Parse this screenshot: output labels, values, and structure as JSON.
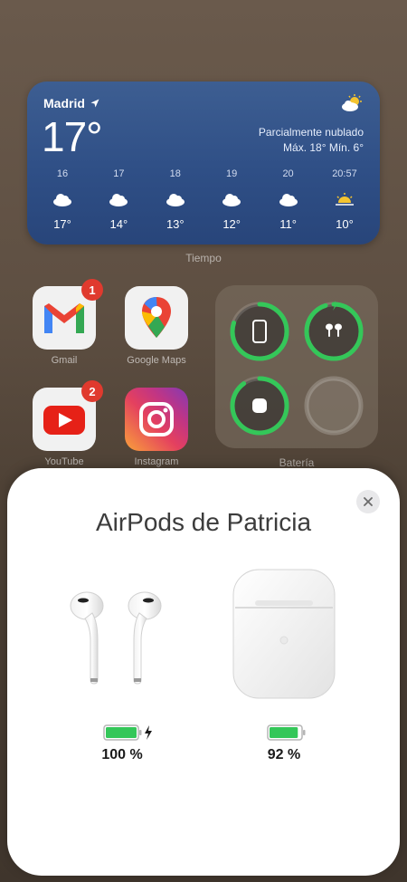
{
  "weather": {
    "city": "Madrid",
    "temp": "17°",
    "condition": "Parcialmente nublado",
    "range": "Máx. 18° Mín. 6°",
    "hours": [
      {
        "h": "16",
        "t": "17°",
        "icon": "cloud-icon"
      },
      {
        "h": "17",
        "t": "14°",
        "icon": "cloud-icon"
      },
      {
        "h": "18",
        "t": "13°",
        "icon": "cloud-icon"
      },
      {
        "h": "19",
        "t": "12°",
        "icon": "cloud-icon"
      },
      {
        "h": "20",
        "t": "11°",
        "icon": "cloud-icon"
      },
      {
        "h": "20:57",
        "t": "10°",
        "icon": "sunset-icon"
      }
    ],
    "label": "Tiempo"
  },
  "apps": {
    "gmail": {
      "label": "Gmail",
      "badge": "1"
    },
    "maps": {
      "label": "Google Maps"
    },
    "youtube": {
      "label": "YouTube",
      "badge": "2"
    },
    "instagram": {
      "label": "Instagram"
    }
  },
  "battery_widget": {
    "label": "Batería",
    "items": [
      {
        "device": "iphone",
        "level": 0.8,
        "icon": "iphone-icon"
      },
      {
        "device": "airpods",
        "level": 0.95,
        "icon": "airpods-icon"
      },
      {
        "device": "case",
        "level": 0.9,
        "icon": "case-icon"
      },
      {
        "device": "empty",
        "level": 0,
        "icon": ""
      }
    ]
  },
  "sheet": {
    "title": "AirPods de Patricia",
    "airpods_percent": "100 %",
    "airpods_level": 1.0,
    "case_percent": "92 %",
    "case_level": 0.92,
    "battery_color": "#34c759"
  }
}
